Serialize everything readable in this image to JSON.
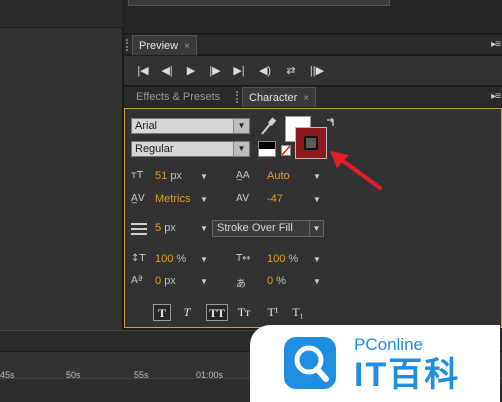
{
  "preview": {
    "tab_label": "Preview",
    "close_glyph": "×",
    "menu_glyph": "▸≡"
  },
  "panel_tabs": {
    "effects_label": "Effects & Presets",
    "character_label": "Character",
    "close_glyph": "×",
    "menu_glyph": "▸≡"
  },
  "character": {
    "font_family": "Arial",
    "font_style": "Regular",
    "font_size": "51",
    "font_size_unit": "px",
    "leading": "Auto",
    "kerning": "Metrics",
    "tracking": "-47",
    "stroke_width": "5",
    "stroke_width_unit": "px",
    "stroke_mode": "Stroke Over Fill",
    "vertical_scale": "100",
    "horizontal_scale": "100",
    "baseline_shift": "0",
    "baseline_shift_unit": "px",
    "tsume": "0",
    "percent": "%",
    "fill_color": "#ffffff",
    "stroke_color": "#8b1a1a"
  },
  "format_buttons": [
    {
      "label": "T"
    },
    {
      "label": "T"
    },
    {
      "label": "TT"
    },
    {
      "label": "Tт"
    },
    {
      "label": "T¹"
    },
    {
      "label": "T₁"
    }
  ],
  "timeline": {
    "ticks": [
      "45s",
      "50s",
      "55s",
      "01:00s"
    ]
  },
  "logo": {
    "line1": "PConline",
    "line2": "IT百科"
  },
  "annotation_color": "#e21e26"
}
